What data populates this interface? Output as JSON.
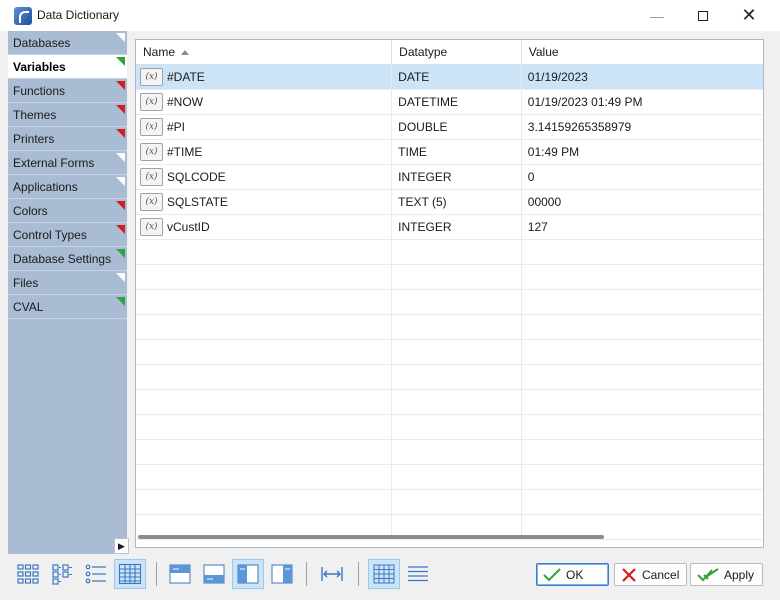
{
  "window": {
    "title": "Data Dictionary"
  },
  "sidebar": {
    "items": [
      {
        "label": "Databases",
        "marker": "white",
        "active": false
      },
      {
        "label": "Variables",
        "marker": "green",
        "active": true
      },
      {
        "label": "Functions",
        "marker": "red",
        "active": false
      },
      {
        "label": "Themes",
        "marker": "red",
        "active": false
      },
      {
        "label": "Printers",
        "marker": "red",
        "active": false
      },
      {
        "label": "External Forms",
        "marker": "white",
        "active": false
      },
      {
        "label": "Applications",
        "marker": "white",
        "active": false
      },
      {
        "label": "Colors",
        "marker": "red",
        "active": false
      },
      {
        "label": "Control Types",
        "marker": "red",
        "active": false
      },
      {
        "label": "Database Settings",
        "marker": "green",
        "active": false
      },
      {
        "label": "Files",
        "marker": "white",
        "active": false
      },
      {
        "label": "CVAL",
        "marker": "green",
        "active": false
      }
    ],
    "scroll_icon": "chevron-right-icon"
  },
  "grid": {
    "columns": [
      "Name",
      "Datatype",
      "Value"
    ],
    "sort_column": "Name",
    "var_icon_text": "(x)",
    "rows": [
      {
        "name": "#DATE",
        "datatype": "DATE",
        "value": "01/19/2023",
        "selected": true
      },
      {
        "name": "#NOW",
        "datatype": "DATETIME",
        "value": "01/19/2023 01:49 PM",
        "selected": false
      },
      {
        "name": "#PI",
        "datatype": "DOUBLE",
        "value": "3.14159265358979",
        "selected": false
      },
      {
        "name": "#TIME",
        "datatype": "TIME",
        "value": "01:49 PM",
        "selected": false
      },
      {
        "name": "SQLCODE",
        "datatype": "INTEGER",
        "value": "0",
        "selected": false
      },
      {
        "name": "SQLSTATE",
        "datatype": "TEXT (5)",
        "value": "00000",
        "selected": false
      },
      {
        "name": "vCustID",
        "datatype": "INTEGER",
        "value": "127",
        "selected": false
      }
    ],
    "empty_rows": 12
  },
  "toolbar": {
    "buttons": [
      {
        "icon": "large-icons-view-icon",
        "on": false
      },
      {
        "icon": "small-icons-view-icon",
        "on": false
      },
      {
        "icon": "list-view-icon",
        "on": false
      },
      {
        "icon": "details-view-icon",
        "on": true
      },
      {
        "icon": "preview-top-icon",
        "on": false
      },
      {
        "icon": "preview-bottom-icon",
        "on": false
      },
      {
        "icon": "preview-left-icon",
        "on": true
      },
      {
        "icon": "preview-right-icon",
        "on": false
      },
      {
        "icon": "fit-columns-icon",
        "on": false
      },
      {
        "icon": "grid-lines-icon",
        "on": true
      },
      {
        "icon": "row-lines-icon",
        "on": false
      }
    ],
    "ok_label": "OK",
    "cancel_label": "Cancel",
    "apply_label": "Apply"
  },
  "colors": {
    "sidebar_bg": "#a9bcd3",
    "selection": "#cce4f7",
    "marker_red": "#d11e1e",
    "marker_green": "#2fa43a",
    "ok_border": "#3b7cc4"
  }
}
